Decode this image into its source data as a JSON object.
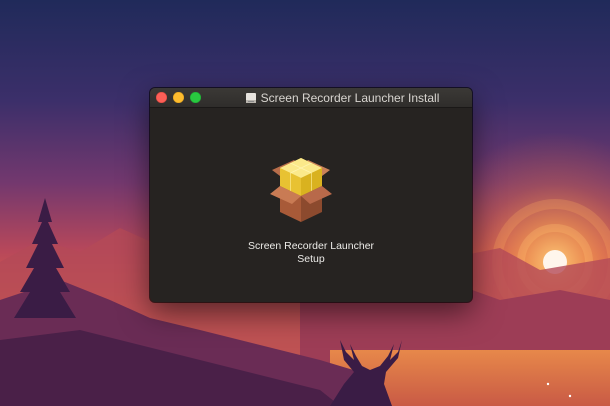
{
  "window": {
    "title": "Screen Recorder Launcher Install",
    "title_icon": "disk-image-icon"
  },
  "package": {
    "icon": "package-box-icon",
    "label_line1": "Screen Recorder Launcher",
    "label_line2": "Setup"
  },
  "colors": {
    "close": "#fc5f57",
    "minimize": "#fdbc2e",
    "maximize": "#29c840",
    "window_bg": "#262321"
  }
}
